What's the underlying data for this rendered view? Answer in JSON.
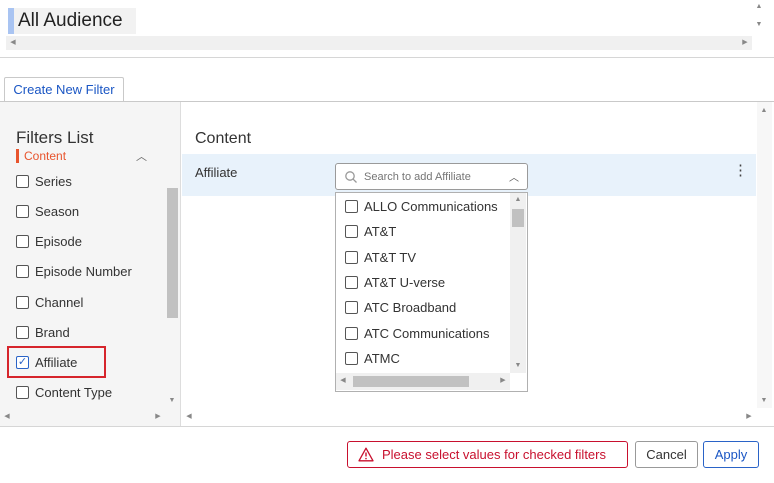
{
  "audience": {
    "title": "All Audience"
  },
  "tabs": [
    {
      "label": "Create New Filter"
    }
  ],
  "filters_panel": {
    "title": "Filters List",
    "section": "Content",
    "items": [
      {
        "label": "Series",
        "checked": false
      },
      {
        "label": "Season",
        "checked": false
      },
      {
        "label": "Episode",
        "checked": false
      },
      {
        "label": "Episode Number",
        "checked": false
      },
      {
        "label": "Channel",
        "checked": false
      },
      {
        "label": "Brand",
        "checked": false
      },
      {
        "label": "Affiliate",
        "checked": true
      },
      {
        "label": "Content Type",
        "checked": false
      }
    ]
  },
  "content_panel": {
    "heading": "Content",
    "row_label": "Affiliate",
    "search_placeholder": "Search to add Affiliate",
    "options": [
      "ALLO Communications",
      "AT&T",
      "AT&T TV",
      "AT&T U-verse",
      "ATC Broadband",
      "ATC Communications",
      "ATMC"
    ]
  },
  "footer": {
    "warning": "Please select values for checked filters",
    "cancel_label": "Cancel",
    "apply_label": "Apply"
  },
  "colors": {
    "accent_blue": "#1a56c4",
    "warning_red": "#c8102e",
    "section_orange": "#e8542d",
    "highlight_red": "#d6252c",
    "row_highlight": "#e8f2fb"
  }
}
